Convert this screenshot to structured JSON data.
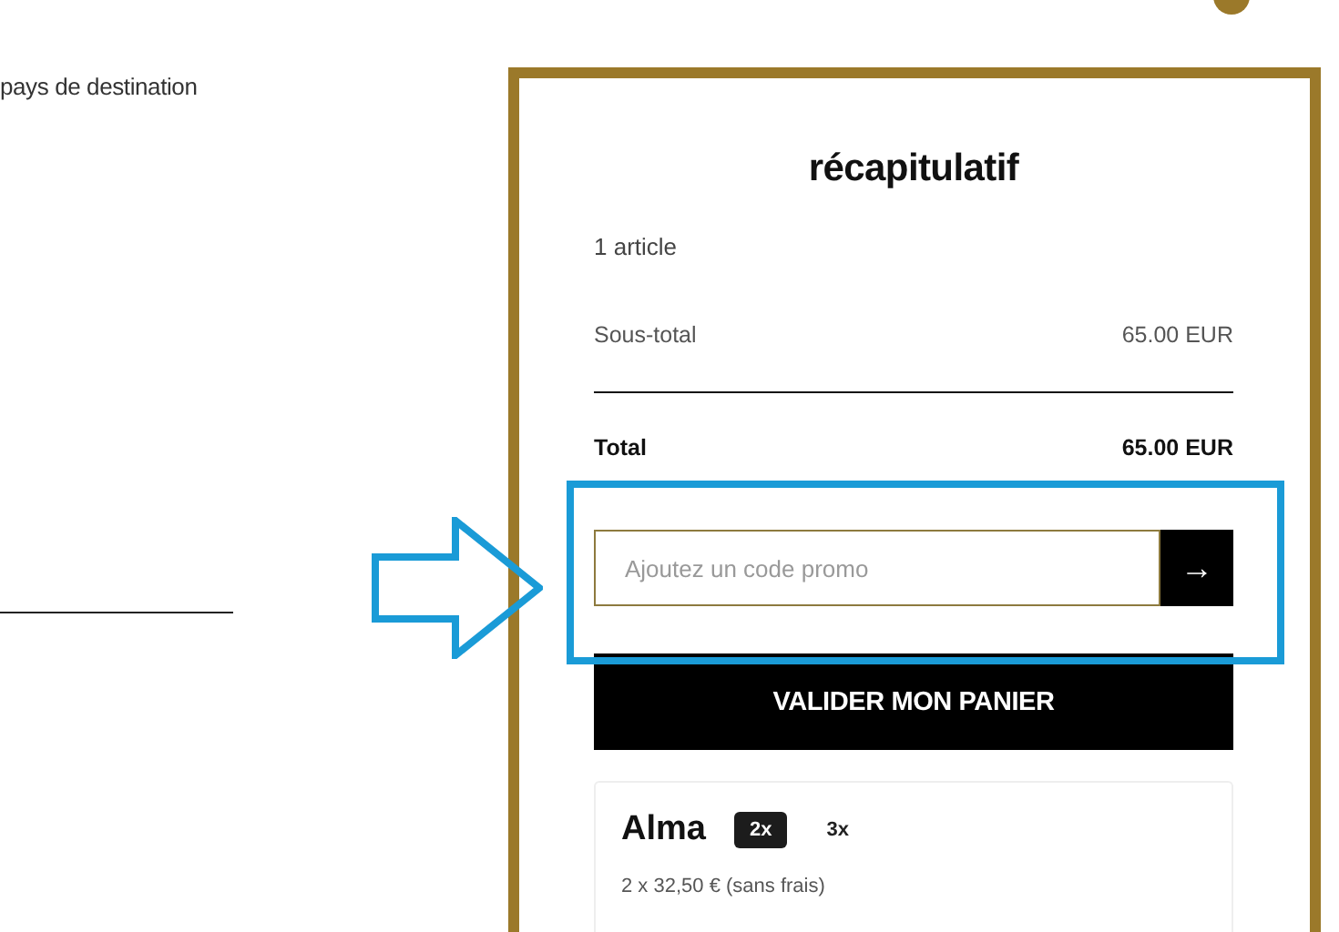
{
  "shipping": {
    "label": "pays de destination"
  },
  "summary": {
    "title": "récapitulatif",
    "item_count": "1 article",
    "subtotal": {
      "label": "Sous-total",
      "value": "65.00 EUR"
    },
    "total": {
      "label": "Total",
      "value": "65.00 EUR"
    },
    "promo": {
      "placeholder": "Ajoutez un code promo",
      "submit": "→"
    },
    "checkout_button": "VALIDER MON PANIER",
    "alma": {
      "logo": "Alma",
      "options": [
        {
          "label": "2x",
          "selected": true
        },
        {
          "label": "3x",
          "selected": false
        }
      ],
      "installment": "2 x 32,50 € (sans frais)"
    }
  }
}
